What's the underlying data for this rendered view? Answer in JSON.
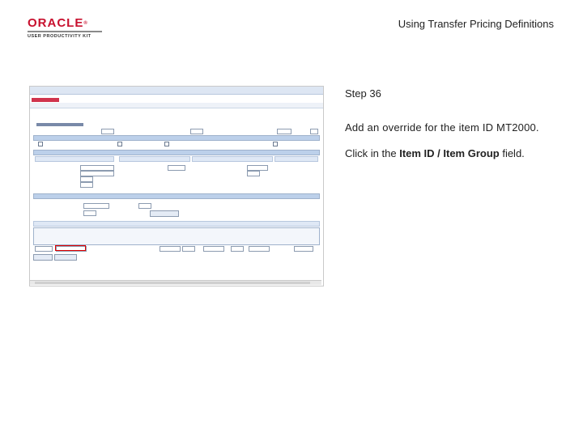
{
  "header": {
    "logo_word": "ORACLE",
    "logo_reg": "®",
    "logo_sub": "USER PRODUCTIVITY KIT",
    "page_title": "Using Transfer Pricing Definitions"
  },
  "step": {
    "label": "Step 36",
    "instruction": "Add an override for the item ID MT2000.",
    "click_prefix": "Click in the ",
    "click_field": "Item ID / Item Group",
    "click_suffix": " field."
  },
  "colors": {
    "oracle_red": "#c8102e",
    "header_blue": "#bcd0ea",
    "highlight_red": "#e00000"
  }
}
